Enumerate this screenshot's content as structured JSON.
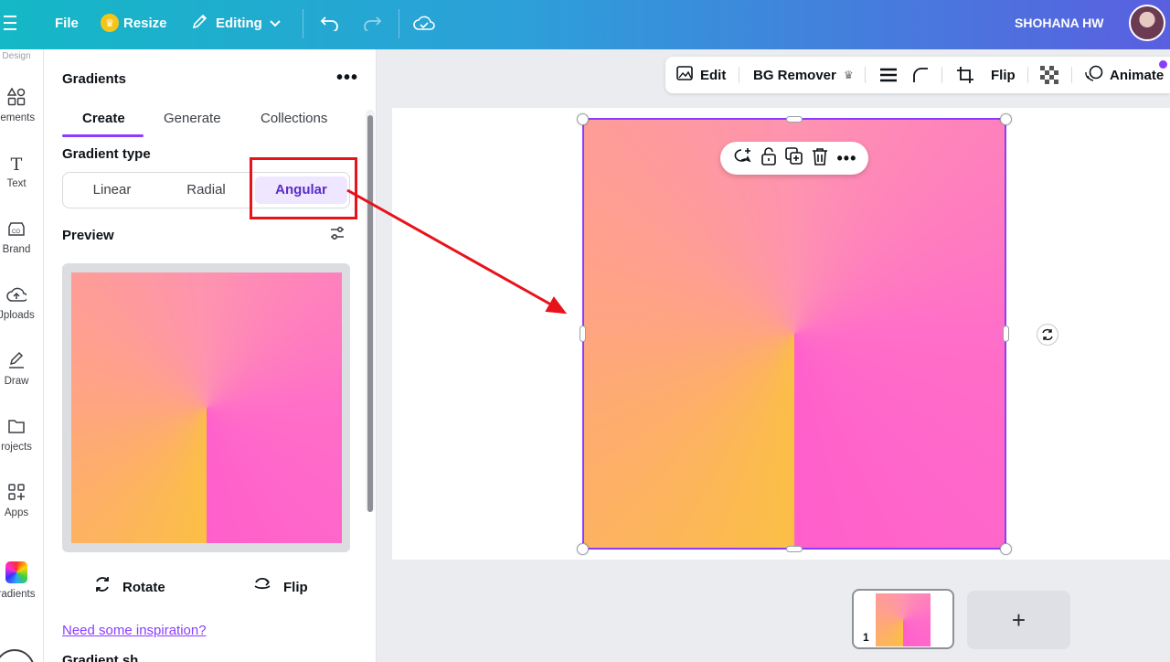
{
  "topbar": {
    "file_label": "File",
    "resize_label": "Resize",
    "editing_label": "Editing",
    "user_name": "SHOHANA HW",
    "icons": [
      "menu-icon",
      "crown-icon",
      "pencil-icon",
      "chevron-down-icon",
      "undo-icon",
      "redo-icon",
      "cloud-save-icon"
    ]
  },
  "rail": {
    "top_cut_label": "Design",
    "items": [
      {
        "label": "lements",
        "icon": "elements-icon"
      },
      {
        "label": "Text",
        "icon": "text-icon"
      },
      {
        "label": "Brand",
        "icon": "brand-icon"
      },
      {
        "label": "Jploads",
        "icon": "upload-icon"
      },
      {
        "label": "Draw",
        "icon": "draw-icon"
      },
      {
        "label": "rojects",
        "icon": "folder-icon"
      },
      {
        "label": "Apps",
        "icon": "apps-icon"
      },
      {
        "label": "radients",
        "icon": "gradient-icon"
      }
    ]
  },
  "panel": {
    "title": "Gradients",
    "tabs": [
      "Create",
      "Generate",
      "Collections"
    ],
    "active_tab": "Create",
    "gradient_type_label": "Gradient type",
    "gradient_types": [
      "Linear",
      "Radial",
      "Angular"
    ],
    "selected_type": "Angular",
    "preview_label": "Preview",
    "rotate_label": "Rotate",
    "flip_label": "Flip",
    "inspiration_link": "Need some inspiration?",
    "cut_label": "Gradient sh..."
  },
  "context_toolbar": {
    "edit_label": "Edit",
    "bg_remover_label": "BG Remover",
    "flip_label": "Flip",
    "animate_label": "Animate"
  },
  "pages": {
    "current_page_number": "1",
    "add_page_symbol": "+"
  },
  "colors": {
    "accent": "#8b3dff",
    "annotation": "#e8121b",
    "gradient_pink": "#ff5fcb",
    "gradient_orange": "#fbbf45",
    "gradient_salmon": "#fe93b0"
  }
}
